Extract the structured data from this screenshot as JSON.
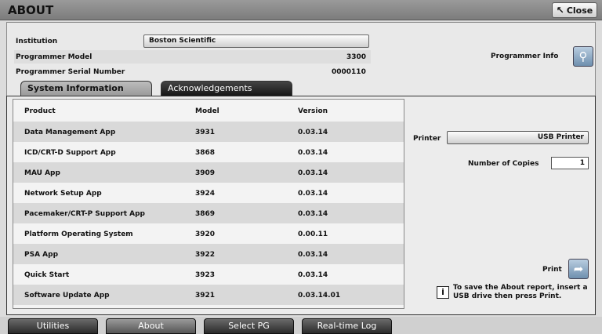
{
  "window": {
    "title": "ABOUT",
    "close_label": "Close",
    "close_icon": "cursor-arrow-icon"
  },
  "institution": {
    "label": "Institution",
    "value": "Boston Scientific"
  },
  "programmer_model": {
    "label": "Programmer Model",
    "value": "3300"
  },
  "programmer_serial": {
    "label": "Programmer Serial Number",
    "value": "0000110"
  },
  "programmer_info": {
    "label": "Programmer Info",
    "icon": "magnify-icon"
  },
  "tabs": [
    {
      "label": "System Information"
    },
    {
      "label": "Acknowledgements"
    }
  ],
  "table": {
    "columns": [
      "Product",
      "Model",
      "Version"
    ],
    "rows": [
      {
        "product": "Data Management App",
        "model": "3931",
        "version": "0.03.14"
      },
      {
        "product": "ICD/CRT-D Support App",
        "model": "3868",
        "version": "0.03.14"
      },
      {
        "product": "MAU App",
        "model": "3909",
        "version": "0.03.14"
      },
      {
        "product": "Network Setup App",
        "model": "3924",
        "version": "0.03.14"
      },
      {
        "product": "Pacemaker/CRT-P Support App",
        "model": "3869",
        "version": "0.03.14"
      },
      {
        "product": "Platform Operating System",
        "model": "3920",
        "version": "0.00.11"
      },
      {
        "product": "PSA App",
        "model": "3922",
        "version": "0.03.14"
      },
      {
        "product": "Quick Start",
        "model": "3923",
        "version": "0.03.14"
      },
      {
        "product": "Software Update App",
        "model": "3921",
        "version": "0.03.14.01"
      }
    ]
  },
  "printer": {
    "label": "Printer",
    "value": "USB Printer"
  },
  "copies": {
    "label": "Number of Copies",
    "value": "1"
  },
  "print": {
    "label": "Print",
    "icon": "print-arrow-icon"
  },
  "note": "To save the About report, insert a USB drive then press Print.",
  "bottom_tabs": [
    {
      "label": "Utilities"
    },
    {
      "label": "About"
    },
    {
      "label": "Select PG"
    },
    {
      "label": "Real-time Log"
    }
  ]
}
